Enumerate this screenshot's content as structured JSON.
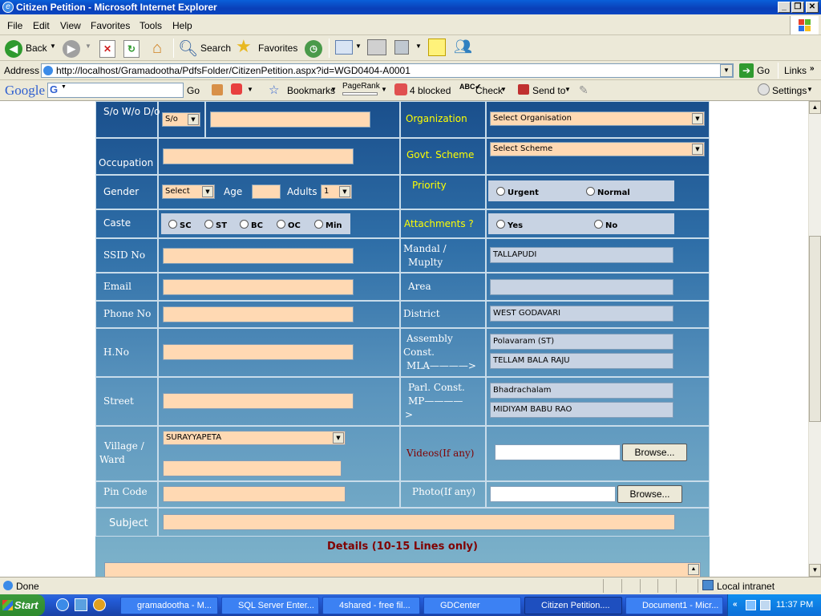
{
  "window": {
    "title": "Citizen Petition - Microsoft Internet Explorer"
  },
  "menu": [
    "File",
    "Edit",
    "View",
    "Favorites",
    "Tools",
    "Help"
  ],
  "toolbar": {
    "back": "Back",
    "search": "Search",
    "favorites": "Favorites"
  },
  "address": {
    "label": "Address",
    "url": "http://localhost/Gramadootha/PdfsFolder/CitizenPetition.aspx?id=WGD0404-A0001",
    "go": "Go",
    "links": "Links"
  },
  "googlebar": {
    "logo": "Google",
    "go": "Go",
    "bookmarks": "Bookmarks",
    "pagerank": "PageRank",
    "blocked": "4 blocked",
    "check": "Check",
    "sendto": "Send to",
    "settings": "Settings"
  },
  "form": {
    "relation_label": "S/o W/o D/o",
    "relation_value": "S/o",
    "organization_label": "Organization",
    "organization_value": "Select Organisation",
    "occupation_label": "Occupation",
    "scheme_label": "Govt. Scheme",
    "scheme_value": "Select Scheme",
    "gender_label": "Gender",
    "gender_value": "Select",
    "age_label": "Age",
    "adults_label": "Adults",
    "adults_value": "1",
    "priority_label": "Priority",
    "priority_options": [
      "Urgent",
      "Normal"
    ],
    "caste_label": "Caste",
    "caste_options": [
      "SC",
      "ST",
      "BC",
      "OC",
      "Min"
    ],
    "attachments_label": "Attachments ?",
    "attachments_options": [
      "Yes",
      "No"
    ],
    "ssid_label": "SSID No",
    "mandal_label_1": "Mandal /",
    "mandal_label_2": "Muplty",
    "mandal_value": "TALLAPUDI",
    "email_label": "Email",
    "area_label": "Area",
    "phone_label": "Phone No",
    "district_label": "District",
    "district_value": "WEST GODAVARI",
    "hno_label": "H.No",
    "assembly_label_1": "Assembly",
    "assembly_label_2": "Const.",
    "assembly_label_3": "MLA————>",
    "assembly_value": "Polavaram (ST)",
    "mla_value": "TELLAM BALA RAJU",
    "street_label": "Street",
    "parl_label_1": "Parl. Const.",
    "parl_label_2": "MP————",
    "parl_label_3": ">",
    "parl_value": "Bhadrachalam",
    "mp_value": "MIDIYAM BABU RAO",
    "village_label_1": "Village /",
    "village_label_2": "Ward",
    "village_value": "SURAYYAPETA",
    "videos_label": "Videos(If any)",
    "browse": "Browse...",
    "pincode_label": "Pin Code",
    "photo_label": "Photo(If any)",
    "subject_label": "Subject",
    "details_label": "Details (10-15 Lines only)"
  },
  "status": {
    "text": "Done",
    "zone": "Local intranet"
  },
  "taskbar": {
    "start": "Start",
    "tasks": [
      "gramadootha - M...",
      "SQL Server Enter...",
      "4shared - free fil...",
      "GDCenter",
      "Citizen Petition....",
      "Document1 - Micr..."
    ],
    "time": "11:37 PM"
  },
  "colors": {
    "input_bg": "#ffd9b3",
    "readonly_bg": "#c8d3e3",
    "label_yellow": "#ffff00",
    "label_maroon": "#800000"
  }
}
